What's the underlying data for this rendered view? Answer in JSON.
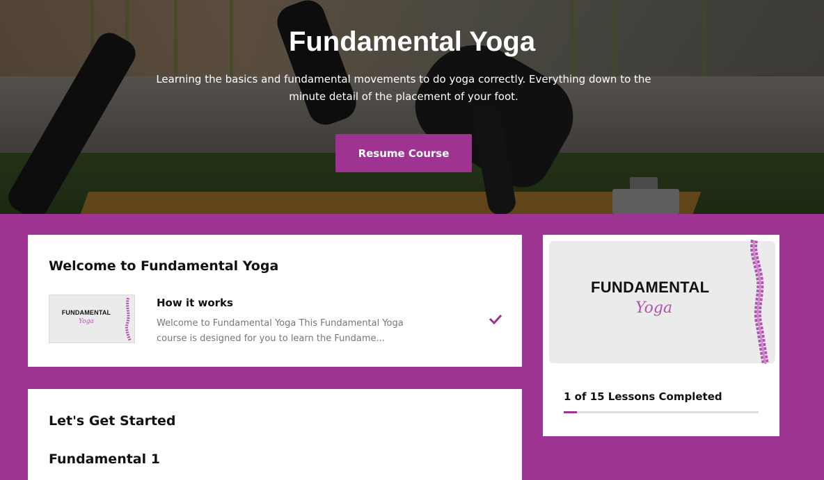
{
  "hero": {
    "title": "Fundamental Yoga",
    "description": "Learning the basics and fundamental movements to do yoga correctly. Everything down to the minute detail of the placement of your foot.",
    "resume_button": "Resume Course"
  },
  "welcome_section": {
    "title": "Welcome to Fundamental Yoga",
    "lesson": {
      "title": "How it works",
      "excerpt": "Welcome to Fundamental Yoga This Fundamental Yoga course is designed for you to learn the Fundame...",
      "thumb_title": "FUNDAMENTAL",
      "thumb_sub": "Yoga",
      "completed": true
    }
  },
  "started_section": {
    "title": "Let's Get Started",
    "module_title": "Fundamental 1"
  },
  "progress_card": {
    "image_title": "FUNDAMENTAL",
    "image_sub": "Yoga",
    "completed_text": "1 of 15 Lessons Completed",
    "completed_lessons": 1,
    "total_lessons": 15
  },
  "colors": {
    "brand": "#9e3391",
    "accent_script": "#b054b0"
  }
}
